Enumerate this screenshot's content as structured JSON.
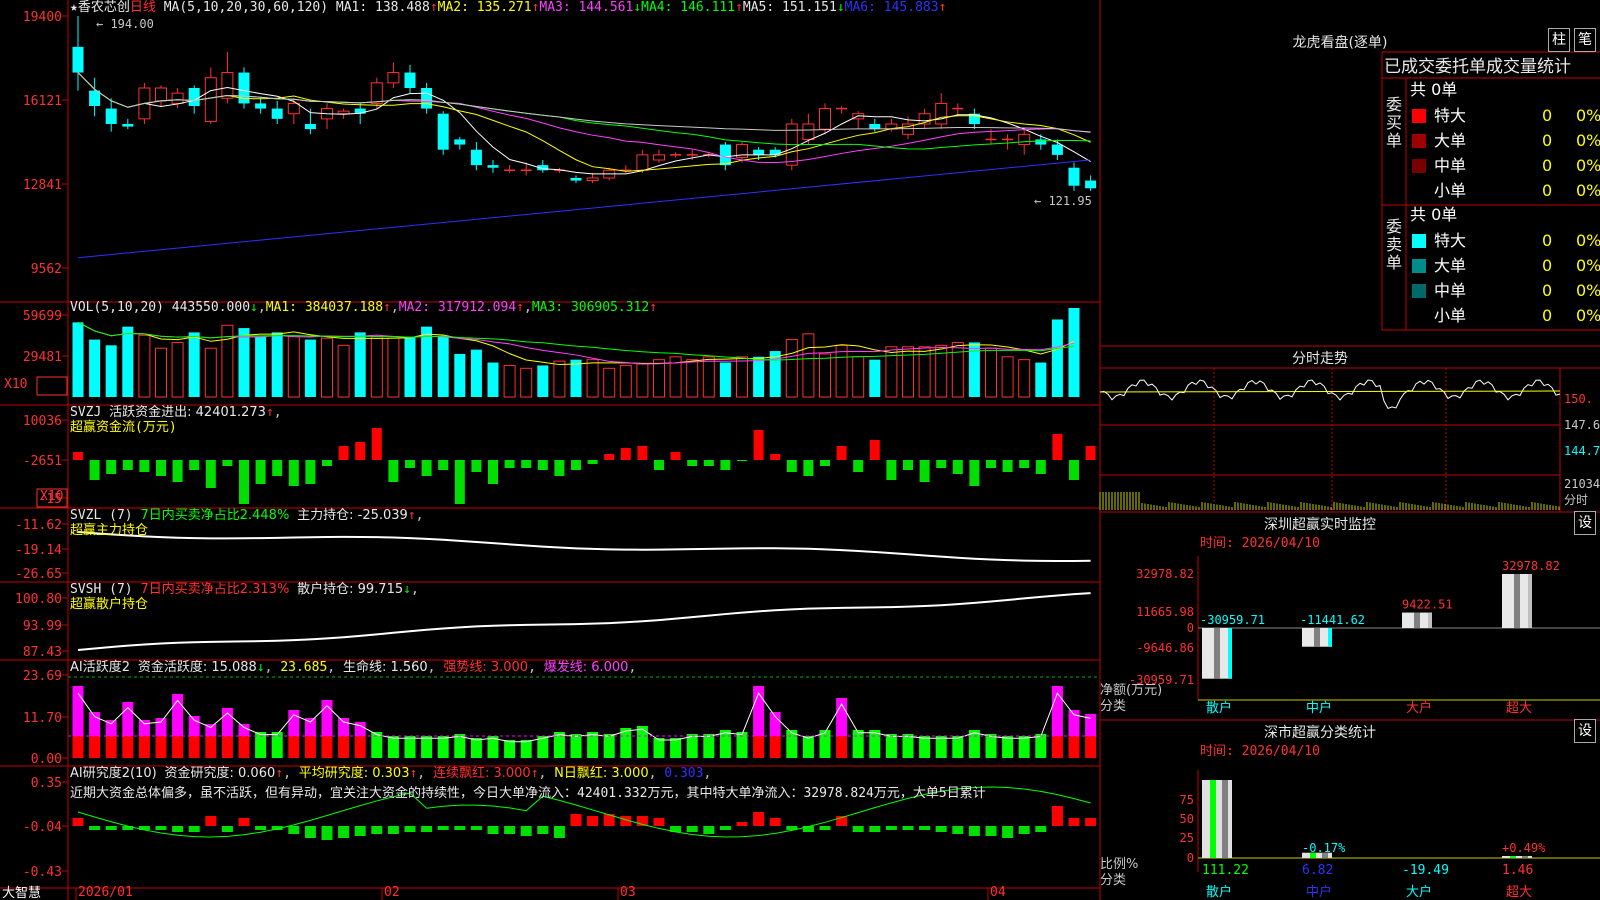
{
  "stock": {
    "name": "香农芯创",
    "period": "日线"
  },
  "main_chart": {
    "ma_label": "MA(5,10,20,30,60,120)",
    "ma1": "MA1: 138.488",
    "ma1_arrow": "↑",
    "ma2": "MA2: 135.271",
    "ma2_arrow": "↑",
    "ma3": "MA3: 144.561",
    "ma3_arrow": "↓",
    "ma4": "MA4: 146.111",
    "ma4_arrow": "↑",
    "ma5": "MA5: 151.151",
    "ma5_arrow": "↓",
    "ma6": "MA6: 145.883",
    "ma6_arrow": "↑",
    "y_ticks": [
      "19400",
      "16121",
      "12841",
      "9562"
    ],
    "high_label": "194.00",
    "low_label": "121.95"
  },
  "vol_chart": {
    "label": "VOL(5,10,20)",
    "value": "443550.000",
    "value_arrow": "↓",
    "ma1": "MA1: 384037.188",
    "ma1_arrow": "↑",
    "ma2": "MA2: 317912.094",
    "ma2_arrow": "↑",
    "ma3": "MA3: 306905.312",
    "ma3_arrow": "↑",
    "y_ticks": [
      "59699",
      "29481"
    ],
    "unit": "X10"
  },
  "svzj": {
    "label": "SVZJ",
    "text": "活跃资金进出: 42401.273",
    "arrow": "↑",
    "sub": "超赢资金流(万元)",
    "y_ticks": [
      "10036",
      "-2651",
      "-15"
    ],
    "unit": "X10"
  },
  "svzl": {
    "label": "SVZL (7)",
    "text1": "7日内买卖净占比2.448%",
    "text2": "主力持仓: -25.039",
    "arrow": "↑",
    "sub": "超赢主力持仓",
    "y_ticks": [
      "-11.62",
      "-19.14",
      "-26.65"
    ]
  },
  "svsh": {
    "label": "SVSH (7)",
    "text1": "7日内买卖净占比2.313%",
    "text2": "散户持仓: 99.715",
    "arrow": "↓",
    "sub": "超赢散户持仓",
    "y_ticks": [
      "100.80",
      "93.99",
      "87.43"
    ]
  },
  "ai_active": {
    "label": "AI活跃度2",
    "t1": "资金活跃度: 15.088",
    "t1_arrow": "↓",
    "t2": "23.685",
    "t3": "生命线: 1.560",
    "t4": "强势线: 3.000",
    "t5": "爆发线: 6.000",
    "y_ticks": [
      "23.69",
      "11.70",
      "0.00"
    ]
  },
  "ai_research": {
    "label": "AI研究度2(10)",
    "t1": "资金研究度: 0.060",
    "t1_arrow": "↑",
    "t2": "平均研究度: 0.303",
    "t2_arrow": "↑",
    "t3": "连续飘红: 3.000",
    "t3_arrow": "↑",
    "t4": "N日飘红: 3.000",
    "t5": "0.303",
    "comment": "近期大资金总体偏多，虽不活跃，但有异动，宜关注大资金的持续性，今日大单净流入：42401.332万元，其中特大单净流入：32978.824万元，大单5日累计",
    "y_ticks": [
      "0.35",
      "-0.04",
      "-0.43"
    ]
  },
  "x_axis": {
    "labels": [
      "2026/01",
      "02",
      "03",
      "04"
    ],
    "brand": "大智慧"
  },
  "longhu": {
    "title": "龙虎看盘(逐单)",
    "btn1": "柱",
    "btn2": "笔",
    "header": "已成交委托单成交量统计",
    "buy_group": "委买单",
    "sell_group": "委卖单",
    "buy_total": "共 0单",
    "sell_total": "共 0单",
    "buy_rows": [
      {
        "label": "特大",
        "count": "0",
        "pct": "0%",
        "color": "#ff0000"
      },
      {
        "label": "大单",
        "count": "0",
        "pct": "0%",
        "color": "#a00000"
      },
      {
        "label": "中单",
        "count": "0",
        "pct": "0%",
        "color": "#780000"
      },
      {
        "label": "小单",
        "count": "0",
        "pct": "0%",
        "color": "#000000"
      }
    ],
    "sell_rows": [
      {
        "label": "特大",
        "count": "0",
        "pct": "0%",
        "color": "#00ffff"
      },
      {
        "label": "大单",
        "count": "0",
        "pct": "0%",
        "color": "#008c8c"
      },
      {
        "label": "中单",
        "count": "0",
        "pct": "0%",
        "color": "#006a6a"
      },
      {
        "label": "小单",
        "count": "0",
        "pct": "0%",
        "color": "#000000"
      }
    ]
  },
  "intraday": {
    "title": "分时走势",
    "y_ticks": [
      "150.",
      "147.6",
      "144.7"
    ],
    "vol_label": "21034",
    "vol_unit": "分时"
  },
  "sz_monitor": {
    "title": "深圳超赢实时监控",
    "btn": "设",
    "time": "时间: 2026/04/10",
    "y_ticks": [
      "32978.82",
      "11665.98",
      "0",
      "-9646.86",
      "-30959.71"
    ],
    "y_unit": "净额(万元)",
    "x_unit": "分类",
    "categories": [
      "散户",
      "中户",
      "大户",
      "超大"
    ],
    "values": [
      -30959.71,
      -11441.62,
      9422.51,
      32978.82
    ],
    "value_labels": [
      "-30959.71",
      "-11441.62",
      "9422.51",
      "32978.82"
    ]
  },
  "sz_class": {
    "title": "深市超赢分类统计",
    "btn": "设",
    "time": "时间: 2026/04/10",
    "y_ticks": [
      "75",
      "50",
      "25",
      "0"
    ],
    "y_unit": "比例%",
    "x_unit": "分类",
    "categories": [
      "散户",
      "中户",
      "大户",
      "超大"
    ],
    "values": [
      111.22,
      6.82,
      -19.49,
      1.46
    ],
    "value_labels": [
      "111.22",
      "6.82",
      "-19.49",
      "1.46"
    ],
    "changes": [
      "",
      "-0.17%",
      "",
      "+0.49%"
    ]
  },
  "colors": {
    "up": "#ff3030",
    "down": "#00ffff",
    "frame": "#c00000"
  }
}
